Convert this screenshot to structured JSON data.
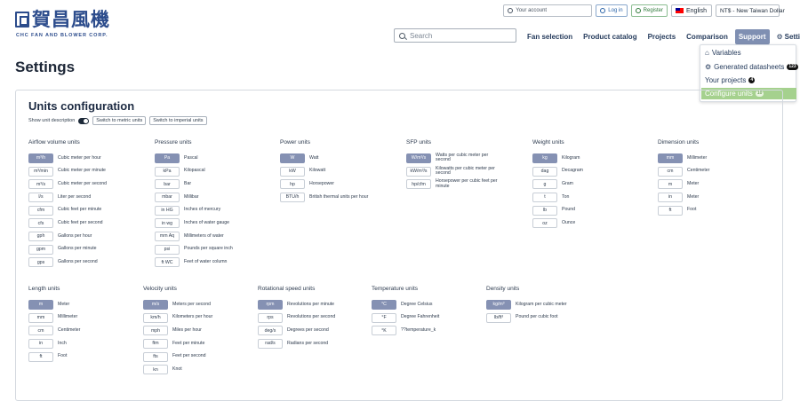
{
  "brand": {
    "name_cn": "賀昌風機",
    "name_en": "CHC FAN AND BLOWER CORP."
  },
  "top_bar": {
    "account": "Your account",
    "login": "Log in",
    "register": "Register",
    "language": "English",
    "currency": "NT$ - New Taiwan Dollar"
  },
  "search": {
    "placeholder": "Search"
  },
  "nav": {
    "items": [
      "Fan selection",
      "Product catalog",
      "Projects",
      "Comparison",
      "Support",
      "Settings"
    ],
    "active": "Support"
  },
  "dropdown": {
    "variables": "Variables",
    "generated": "Generated datasheets",
    "generated_count": "123",
    "projects": "Your projects",
    "projects_count": "4",
    "configure": "Configure units",
    "configure_count": "10"
  },
  "page": {
    "title": "Settings"
  },
  "units": {
    "title": "Units configuration",
    "show_description": "Show unit description",
    "metric_btn": "Switch to metric units",
    "imperial_btn": "Switch to imperial units",
    "groups": [
      {
        "title": "Airflow volume units",
        "units": [
          {
            "code": "m³/h",
            "label": "Cubic meter per hour",
            "selected": true
          },
          {
            "code": "m³/min",
            "label": "Cubic meter per minute"
          },
          {
            "code": "m³/s",
            "label": "Cubic meter per second"
          },
          {
            "code": "l/s",
            "label": "Liter per second"
          },
          {
            "code": "cfm",
            "label": "Cubic feet per minute"
          },
          {
            "code": "cfs",
            "label": "Cubic feet per second"
          },
          {
            "code": "gph",
            "label": "Gallons per hour"
          },
          {
            "code": "gpm",
            "label": "Gallons per minute"
          },
          {
            "code": "gps",
            "label": "Gallons per second"
          }
        ]
      },
      {
        "title": "Pressure units",
        "units": [
          {
            "code": "Pa",
            "label": "Pascal",
            "selected": true
          },
          {
            "code": "kPa",
            "label": "Kilopascal"
          },
          {
            "code": "bar",
            "label": "Bar"
          },
          {
            "code": "mbar",
            "label": "Millibar"
          },
          {
            "code": "in HG",
            "label": "Inches of mercury"
          },
          {
            "code": "in wg",
            "label": "Inches of water gauge"
          },
          {
            "code": "mm Aq",
            "label": "Millimeters of water"
          },
          {
            "code": "psi",
            "label": "Pounds per square inch"
          },
          {
            "code": "ft WC",
            "label": "Feet of water column"
          }
        ]
      },
      {
        "title": "Power units",
        "units": [
          {
            "code": "W",
            "label": "Watt",
            "selected": true
          },
          {
            "code": "kW",
            "label": "Kilowatt"
          },
          {
            "code": "hp",
            "label": "Horsepower"
          },
          {
            "code": "BTU/h",
            "label": "British thermal units per hour"
          }
        ]
      },
      {
        "title": "SFP units",
        "units": [
          {
            "code": "W/m³/s",
            "label": "Watts per cubic meter per second",
            "selected": true
          },
          {
            "code": "kW/m³/s",
            "label": "Kilowatts per cubic meter per second"
          },
          {
            "code": "hp/cfm",
            "label": "Horsepower per cubic feet per minute"
          }
        ]
      },
      {
        "title": "Weight units",
        "units": [
          {
            "code": "kg",
            "label": "Kilogram",
            "selected": true
          },
          {
            "code": "dag",
            "label": "Decagram"
          },
          {
            "code": "g",
            "label": "Gram"
          },
          {
            "code": "t",
            "label": "Ton"
          },
          {
            "code": "lb",
            "label": "Pound"
          },
          {
            "code": "oz",
            "label": "Ounce"
          }
        ]
      },
      {
        "title": "Dimension units",
        "units": [
          {
            "code": "mm",
            "label": "Millimeter",
            "selected": true
          },
          {
            "code": "cm",
            "label": "Centimeter"
          },
          {
            "code": "m",
            "label": "Meter"
          },
          {
            "code": "in",
            "label": "Meter"
          },
          {
            "code": "ft",
            "label": "Foot"
          }
        ]
      },
      {
        "title": "Length units",
        "units": [
          {
            "code": "m",
            "label": "Meter",
            "selected": true
          },
          {
            "code": "mm",
            "label": "Millimeter"
          },
          {
            "code": "cm",
            "label": "Centimeter"
          },
          {
            "code": "in",
            "label": "Inch"
          },
          {
            "code": "ft",
            "label": "Foot"
          }
        ]
      },
      {
        "title": "Velocity units",
        "units": [
          {
            "code": "m/s",
            "label": "Meters per second",
            "selected": true
          },
          {
            "code": "km/h",
            "label": "Kilometers per hour"
          },
          {
            "code": "mph",
            "label": "Miles per hour"
          },
          {
            "code": "ftm",
            "label": "Feet per minute"
          },
          {
            "code": "fts",
            "label": "Feet per second"
          },
          {
            "code": "kn",
            "label": "Knot"
          }
        ]
      },
      {
        "title": "Rotational speed units",
        "units": [
          {
            "code": "rpm",
            "label": "Revolutions per minute",
            "selected": true
          },
          {
            "code": "rps",
            "label": "Revolutions per second"
          },
          {
            "code": "deg/s",
            "label": "Degrees per second"
          },
          {
            "code": "rad/s",
            "label": "Radians per second"
          }
        ]
      },
      {
        "title": "Temperature units",
        "units": [
          {
            "code": "°C",
            "label": "Degree Celsius",
            "selected": true
          },
          {
            "code": "°F",
            "label": "Degree Fahrenheit"
          },
          {
            "code": "°K",
            "label": "??temperature_k"
          }
        ]
      },
      {
        "title": "Density units",
        "units": [
          {
            "code": "kg/m³",
            "label": "Kilogram per cubic meter",
            "selected": true
          },
          {
            "code": "lb/ft³",
            "label": "Pound per cubic foot"
          }
        ]
      }
    ]
  }
}
